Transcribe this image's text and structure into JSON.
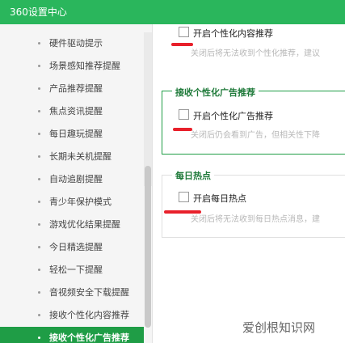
{
  "window": {
    "title": "360设置中心"
  },
  "sidebar": {
    "items": [
      {
        "label": "硬件驱动提示"
      },
      {
        "label": "场景感知推荐提醒"
      },
      {
        "label": "产品推荐提醒"
      },
      {
        "label": "焦点资讯提醒"
      },
      {
        "label": "每日趣玩提醒"
      },
      {
        "label": "长期未关机提醒"
      },
      {
        "label": "自动追剧提醒"
      },
      {
        "label": "青少年保护模式"
      },
      {
        "label": "游戏优化结果提醒"
      },
      {
        "label": "今日精选提醒"
      },
      {
        "label": "轻松一下提醒"
      },
      {
        "label": "音视频安全下载提醒"
      },
      {
        "label": "接收个性化内容推荐"
      },
      {
        "label": "接收个性化广告推荐"
      }
    ],
    "active_index": 13
  },
  "sections": {
    "content_rec": {
      "option_label": "开启个性化内容推荐",
      "checked": false,
      "description": "关闭后将无法收到个性化推荐，建议"
    },
    "ad_rec": {
      "title": "接收个性化广告推荐",
      "option_label": "开启个性化广告推荐",
      "checked": false,
      "description": "关闭后仍会看到广告，但相关性下降"
    },
    "hot": {
      "title": "每日热点",
      "option_label": "开启每日热点",
      "checked": false,
      "description": "关闭后将无法收到每日热点消息，建"
    }
  },
  "watermark": "爱创根知识网",
  "colors": {
    "titlebar": "#2ab65c",
    "accent": "#1f9d46",
    "annotation": "#e8202b"
  }
}
